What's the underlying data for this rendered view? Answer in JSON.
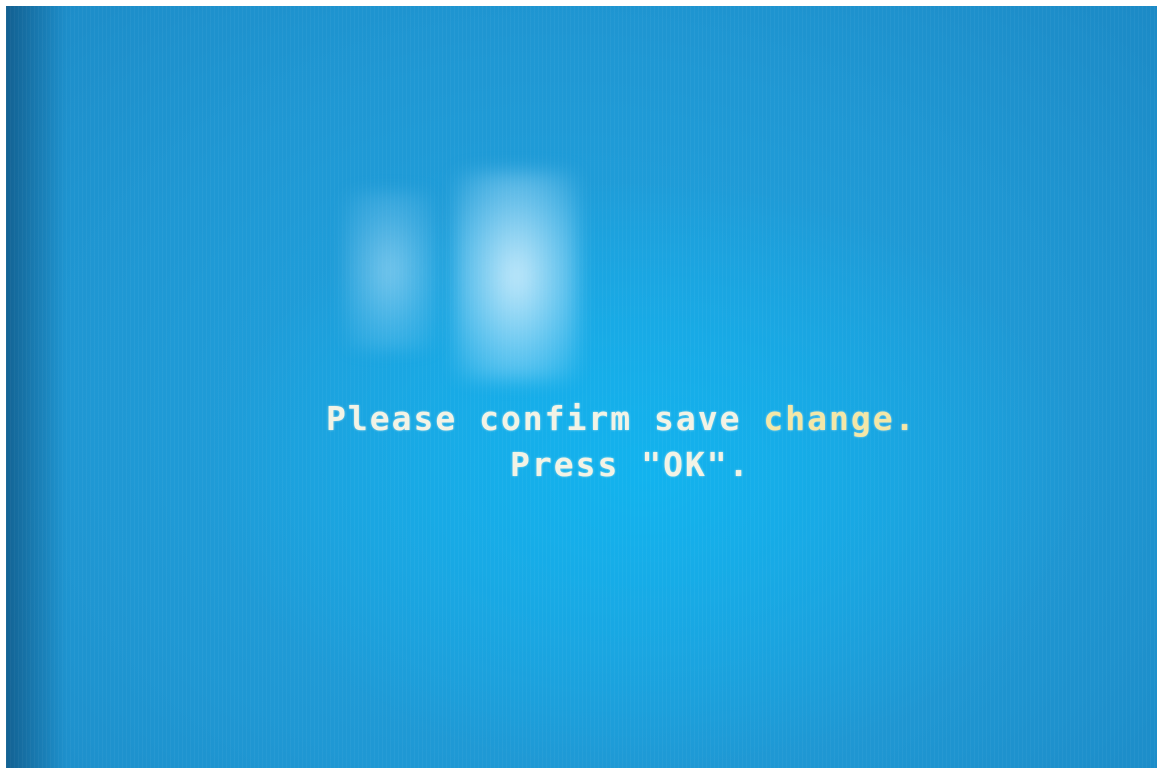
{
  "dialog": {
    "line1_lead": "Please confirm save ",
    "line1_highlight": "change.",
    "line2": "Press \"OK\"."
  },
  "colors": {
    "screen_background": "#1f97d3",
    "text": "#f2f3e6",
    "highlight_text": "#f3e7a8"
  }
}
